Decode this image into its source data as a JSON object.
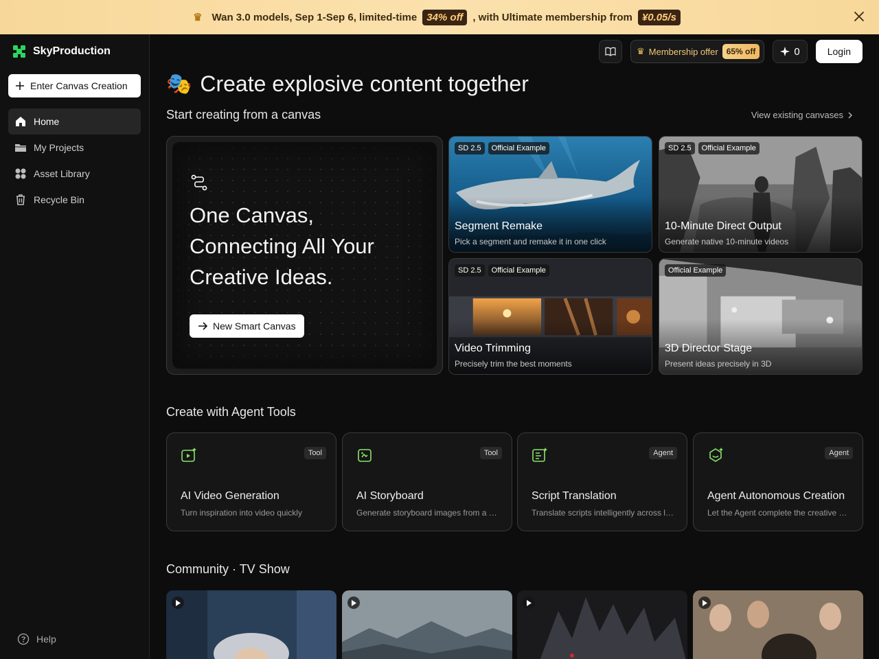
{
  "banner": {
    "text_before": "Wan 3.0 models, Sep 1-Sep 6, limited-time",
    "discount": "34% off",
    "text_middle": ", with Ultimate membership from",
    "price": "¥0.05/s"
  },
  "sidebar": {
    "brand": "SkyProduction",
    "enter_button": "Enter Canvas Creation",
    "items": [
      {
        "label": "Home",
        "icon": "home-icon",
        "active": true
      },
      {
        "label": "My Projects",
        "icon": "folder-icon"
      },
      {
        "label": "Asset Library",
        "icon": "grid-icon"
      },
      {
        "label": "Recycle Bin",
        "icon": "trash-icon"
      }
    ],
    "help": "Help"
  },
  "header": {
    "membership_label": "Membership offer",
    "membership_discount": "65% off",
    "credits": "0",
    "login": "Login"
  },
  "main": {
    "title_emoji": "🎭",
    "title": "Create explosive content together",
    "subtitle": "Start creating from a canvas",
    "view_existing": "View existing canvases",
    "hero": {
      "text": "One Canvas, Connecting All Your Creative Ideas.",
      "button": "New Smart Canvas"
    },
    "cards": [
      {
        "tags": [
          "SD 2.5",
          "Official Example"
        ],
        "title": "Segment Remake",
        "subtitle": "Pick a segment and remake it in one click"
      },
      {
        "tags": [
          "SD 2.5",
          "Official Example"
        ],
        "title": "10-Minute Direct Output",
        "subtitle": "Generate native 10-minute videos"
      },
      {
        "tags": [
          "SD 2.5",
          "Official Example"
        ],
        "title": "Video Trimming",
        "subtitle": "Precisely trim the best moments"
      },
      {
        "tags": [
          "Official Example"
        ],
        "title": "3D Director Stage",
        "subtitle": "Present ideas precisely in 3D"
      }
    ],
    "agent_section": "Create with Agent Tools",
    "tools": [
      {
        "badge": "Tool",
        "title": "AI Video Generation",
        "desc": "Turn inspiration into video quickly"
      },
      {
        "badge": "Tool",
        "title": "AI Storyboard",
        "desc": "Generate storyboard images from a …"
      },
      {
        "badge": "Agent",
        "title": "Script Translation",
        "desc": "Translate scripts intelligently across l…"
      },
      {
        "badge": "Agent",
        "title": "Agent Autonomous Creation",
        "desc": "Let the Agent complete the creative …"
      }
    ],
    "community_section": "Community · TV Show"
  },
  "colors": {
    "accent_green": "#22c55e",
    "banner_bg": "#f8d89a",
    "badge_dark": "#3a2413"
  }
}
